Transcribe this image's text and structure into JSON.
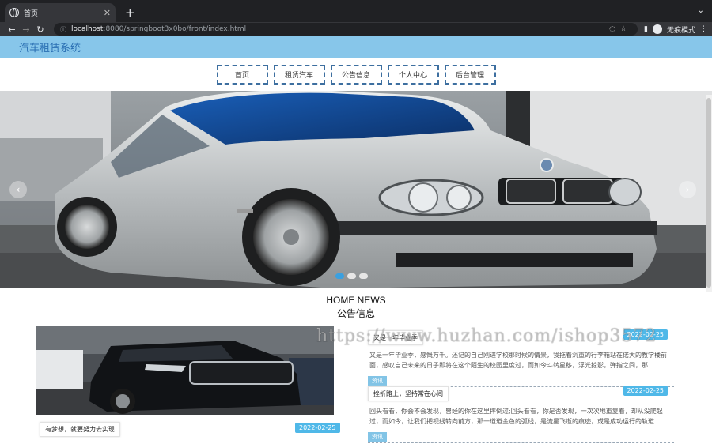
{
  "browser": {
    "tab_title": "首页",
    "new_tab": "+",
    "tab_menu": "⌄",
    "url_host": "localhost",
    "url_path": ":8080/springboot3x0bo/front/index.html",
    "incognito_label": "无痕模式"
  },
  "site": {
    "title": "汽车租赁系统"
  },
  "nav": {
    "items": [
      "首页",
      "租赁汽车",
      "公告信息",
      "个人中心",
      "后台管理"
    ]
  },
  "carousel": {
    "prev": "‹",
    "next": "›",
    "slide_count": 3,
    "active_slide": 1
  },
  "section": {
    "title_en": "HOME NEWS",
    "title_cn": "公告信息"
  },
  "featured": {
    "caption": "有梦想，就要努力去实现",
    "date": "2022-02-25"
  },
  "news": [
    {
      "title": "又是一年毕业季",
      "date": "2022-02-25",
      "body": "又是一年毕业季，感慨万千。还记的自己刚进学校那时候的情景，我拖着沉重的行李箱站在偌大的教学楼前面，感叹自己未来的日子即将在这个陌生的校园里度过，而如今斗转星移，浮光掠影，弹指之间，那…",
      "tag": "资讯"
    },
    {
      "title": "挫折路上，坚持常在心间",
      "date": "2022-02-25",
      "body": "回头看看，你会不会发现，曾经的你在这里摔倒过;回头看看，你是否发现，一次次地重复着，却从没爬起过，而如今，让我们把视线转向前方，那一道道金色的弧线，是流星飞逝的痕迹，或是成功运行的轨道…",
      "tag": "资讯"
    }
  ],
  "watermark": "https://www.huzhan.com/ishop3572"
}
